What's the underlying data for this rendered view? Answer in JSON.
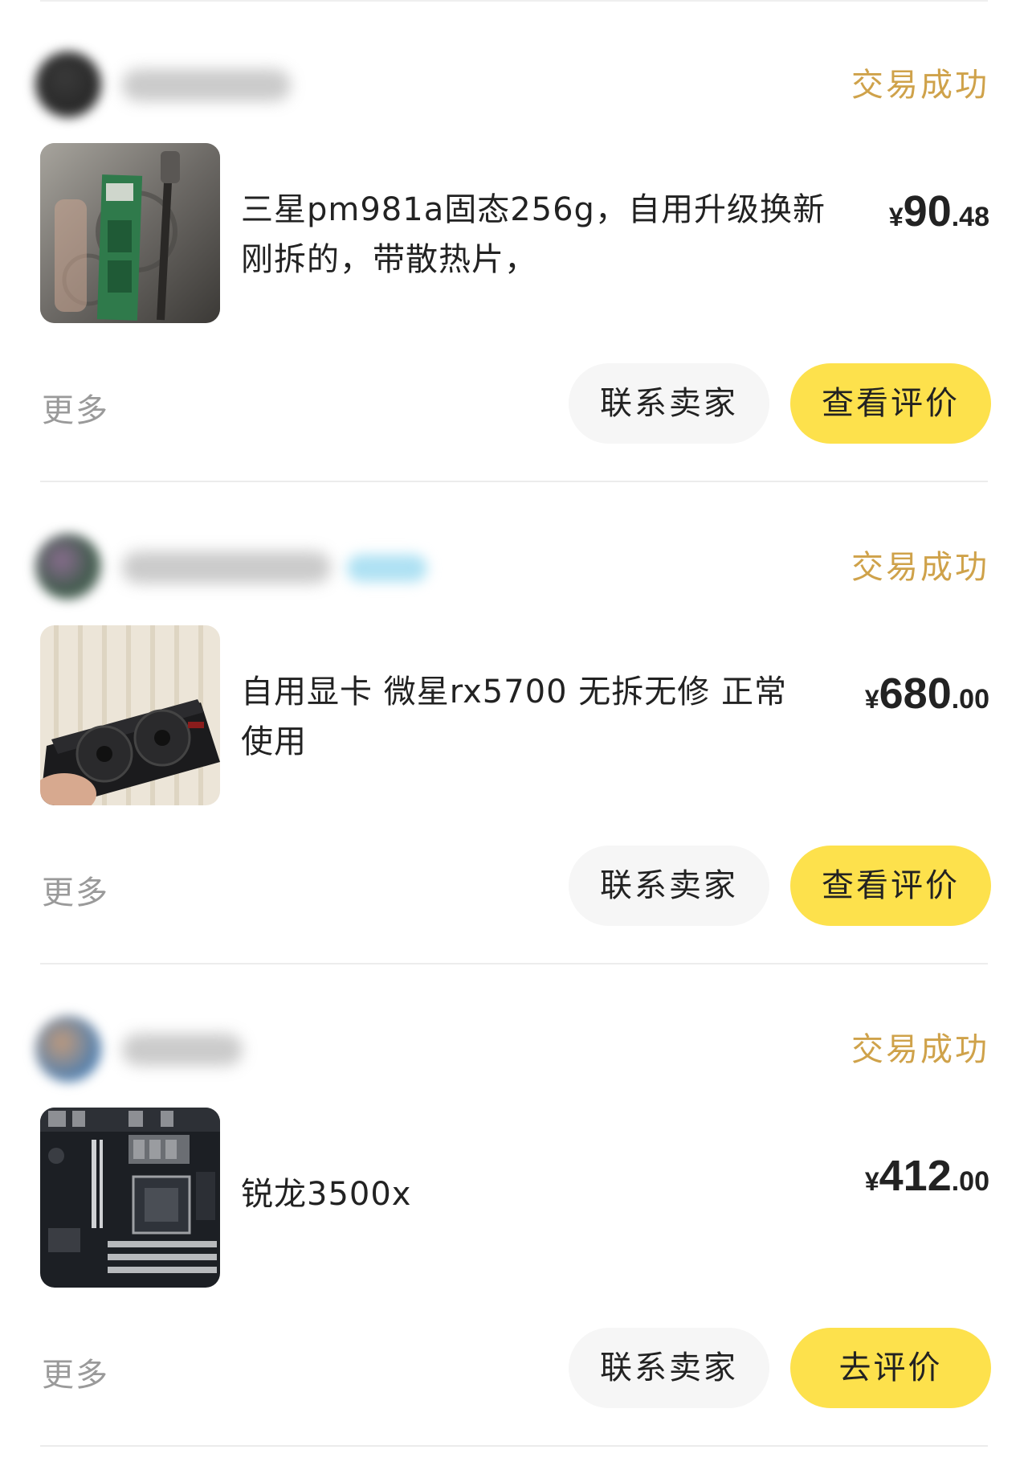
{
  "accent_colors": {
    "status": "#cfa24a",
    "primary_button": "#fde14c",
    "secondary_button": "#f6f6f6"
  },
  "orders": [
    {
      "seller_avatar_icon": "blurred-avatar",
      "status": "交易成功",
      "product_title": "三星pm981a固态256g，自用升级换新\n刚拆的，带散热片，",
      "thumbnail_icon": "ssd-photo",
      "price": {
        "currency": "¥",
        "integer": "90",
        "decimal": ".48"
      },
      "more_label": "更多",
      "contact_label": "联系卖家",
      "review_label": "查看评价"
    },
    {
      "seller_avatar_icon": "blurred-avatar",
      "status": "交易成功",
      "product_title": "自用显卡 微星rx5700 无拆无修 正常\n使用",
      "thumbnail_icon": "graphics-card-photo",
      "price": {
        "currency": "¥",
        "integer": "680",
        "decimal": ".00"
      },
      "more_label": "更多",
      "contact_label": "联系卖家",
      "review_label": "查看评价"
    },
    {
      "seller_avatar_icon": "blurred-avatar",
      "status": "交易成功",
      "product_title": "锐龙3500x",
      "thumbnail_icon": "motherboard-photo",
      "price": {
        "currency": "¥",
        "integer": "412",
        "decimal": ".00"
      },
      "more_label": "更多",
      "contact_label": "联系卖家",
      "review_label": "去评价"
    }
  ]
}
